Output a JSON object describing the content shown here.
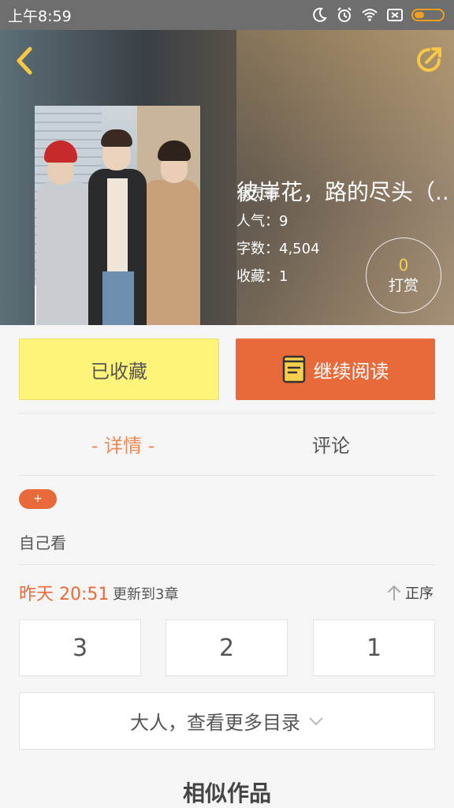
{
  "status_bar": {
    "time": "上午8:59"
  },
  "colors": {
    "accent": "#e86a3a",
    "collected_bg": "#fdf479",
    "tip_count": "#f6d04d",
    "header_icon": "#f6c844"
  },
  "icons": {
    "back": "chevron-left-icon",
    "share": "share-icon",
    "read": "book-icon",
    "sort": "arrow-up-icon",
    "more": "chevron-down-icon"
  },
  "book": {
    "title": "彼岸花，路的尽头（...",
    "author": "澜灵寄",
    "popularity": "人气：9",
    "word_count": "字数：4,504",
    "favorites": "收藏：1",
    "tip_count": "0",
    "tip_label": "打赏"
  },
  "actions": {
    "collected_label": "已收藏",
    "continue_label": "继续阅读"
  },
  "tabs": {
    "details": "- 详情 -",
    "comments": "评论"
  },
  "tag_add_label": "+",
  "description": "自己看",
  "update": {
    "time": "昨天 20:51",
    "text": "更新到3章",
    "sort_label": "正序"
  },
  "chapters": [
    "3",
    "2",
    "1"
  ],
  "more_directory": "大人，查看更多目录",
  "similar_title": "相似作品"
}
